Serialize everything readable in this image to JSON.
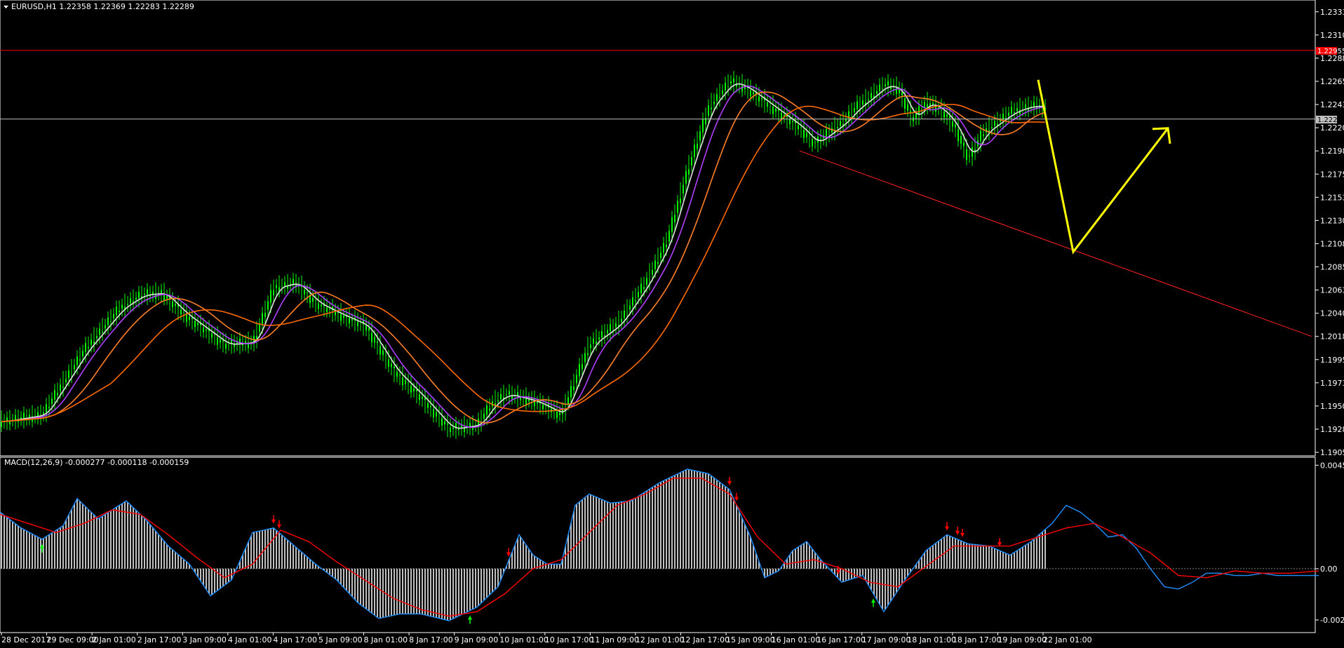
{
  "window": {
    "symbol_header": "EURUSD,H1  1.22358 1.22369 1.22283 1.22289",
    "macd_header": "MACD(12,26,9) -0.000277 -0.000118 -0.000159"
  },
  "colors": {
    "background": "#000000",
    "candles": "#00ff00",
    "ma_fast": "#e0e0e0",
    "ma_purple": "#b040ff",
    "ma_orange": "#ff7f27",
    "ma_slow": "#ff6a00",
    "resistance": "#ff0000",
    "trendline": "#ff2020",
    "forecast": "#ffff00",
    "macd_main": "#1e90ff",
    "macd_signal": "#ff0000",
    "histogram": "#c0c0c0"
  },
  "chart_data": [
    {
      "type": "line",
      "title": "EURUSD,H1",
      "y_ticks": [
        "1.23330",
        "1.23105",
        "1.22880",
        "1.22655",
        "1.22430",
        "1.22205",
        "1.21980",
        "1.21755",
        "1.21530",
        "1.21305",
        "1.21080",
        "1.20855",
        "1.20630",
        "1.20405",
        "1.20180",
        "1.19955",
        "1.19730",
        "1.19505",
        "1.19280",
        "1.19055"
      ],
      "ylim": [
        1.19055,
        1.2339
      ],
      "x_ticks": [
        "28 Dec 2017",
        "29 Dec 09:00",
        "2 Jan 01:00",
        "2 Jan 17:00",
        "3 Jan 09:00",
        "4 Jan 01:00",
        "4 Jan 17:00",
        "5 Jan 09:00",
        "8 Jan 01:00",
        "8 Jan 17:00",
        "9 Jan 09:00",
        "10 Jan 01:00",
        "10 Jan 17:00",
        "11 Jan 09:00",
        "12 Jan 01:00",
        "12 Jan 17:00",
        "15 Jan 09:00",
        "16 Jan 01:00",
        "16 Jan 17:00",
        "17 Jan 09:00",
        "18 Jan 01:00",
        "18 Jan 17:00",
        "19 Jan 09:00",
        "22 Jan 01:00"
      ],
      "price_labels": {
        "resistance": "1.22955",
        "current": "1.22289"
      },
      "close_series": {
        "x": [
          0,
          60,
          120,
          170,
          200,
          230,
          260,
          300,
          320,
          360,
          390,
          420,
          450,
          480,
          520,
          560,
          600,
          640,
          680,
          700,
          720,
          760,
          800,
          840,
          880,
          920,
          950,
          980,
          1010,
          1040,
          1060,
          1080,
          1100,
          1120,
          1140,
          1160,
          1200,
          1220,
          1240,
          1260,
          1280,
          1300,
          1320,
          1340,
          1360,
          1380,
          1400,
          1420,
          1440,
          1460,
          1480,
          1500,
          1520,
          1540,
          1560,
          1580,
          1600,
          1620,
          1640,
          1660,
          1680,
          1700,
          1720,
          1740,
          1760,
          1780,
          1800,
          1820,
          1840,
          1860,
          1880
        ],
        "y": [
          1.1935,
          1.1942,
          1.2005,
          1.2045,
          1.2058,
          1.206,
          1.204,
          1.202,
          1.201,
          1.2012,
          1.2065,
          1.207,
          1.205,
          1.204,
          1.2028,
          1.1985,
          1.1958,
          1.1928,
          1.1932,
          1.1952,
          1.1962,
          1.1955,
          1.1942,
          1.201,
          1.203,
          1.207,
          1.211,
          1.218,
          1.224,
          1.2265,
          1.226,
          1.225,
          1.224,
          1.223,
          1.222,
          1.2205,
          1.2225,
          1.224,
          1.225,
          1.2262,
          1.2258,
          1.2228,
          1.2245,
          1.2238,
          1.2222,
          1.219,
          1.2215,
          1.2225,
          1.2235,
          1.224,
          1.2242,
          1.2236,
          1.2258,
          1.2275,
          1.226,
          1.2245,
          1.224,
          1.2233,
          1.224,
          1.2245,
          1.225,
          1.2248,
          1.224,
          1.2233,
          1.2236,
          1.224,
          1.226,
          1.225,
          1.224,
          1.2232,
          1.2229
        ]
      },
      "moving_averages": [
        {
          "color_key": "ma_fast",
          "period": 5
        },
        {
          "color_key": "ma_purple",
          "period": 10
        },
        {
          "color_key": "ma_orange",
          "period": 20
        },
        {
          "color_key": "ma_slow",
          "period": 40
        }
      ],
      "annotations": {
        "resistance_price": 1.22955,
        "current_price": 1.22289,
        "trendline": [
          [
            1140,
            1.2198
          ],
          [
            1870,
            1.2018
          ]
        ],
        "forecast": [
          [
            1480,
            1.2267
          ],
          [
            1530,
            1.21
          ],
          [
            1665,
            1.222
          ]
        ]
      }
    },
    {
      "type": "bar",
      "title": "MACD(12,26,9)",
      "y_ticks": [
        "0.004572",
        "0.00",
        "-0.002266"
      ],
      "ylim": [
        -0.0027,
        0.0048
      ],
      "main_line": {
        "x": [
          0,
          30,
          60,
          90,
          110,
          140,
          180,
          210,
          240,
          270,
          300,
          330,
          360,
          390,
          420,
          450,
          480,
          510,
          540,
          570,
          600,
          640,
          680,
          710,
          740,
          760,
          780,
          800,
          820,
          840,
          870,
          900,
          940,
          980,
          1010,
          1040,
          1070,
          1090,
          1110,
          1130,
          1150,
          1170,
          1200,
          1230,
          1260,
          1290,
          1320,
          1350,
          1380,
          1410,
          1440,
          1470,
          1500,
          1520,
          1540,
          1560,
          1580,
          1600,
          1620,
          1640,
          1660,
          1680,
          1700,
          1720,
          1740,
          1760,
          1780,
          1800,
          1820,
          1840,
          1860,
          1880
        ],
        "y": [
          0.0025,
          0.0018,
          0.0013,
          0.0019,
          0.0031,
          0.0022,
          0.003,
          0.0021,
          0.001,
          0.0002,
          -0.0012,
          -0.0005,
          0.0016,
          0.0018,
          0.001,
          0.0002,
          -0.0005,
          -0.0015,
          -0.0022,
          -0.002,
          -0.002,
          -0.0023,
          -0.0017,
          -0.0008,
          0.0015,
          0.0006,
          0.0002,
          0.0002,
          0.0028,
          0.0033,
          0.0029,
          0.003,
          0.0038,
          0.0044,
          0.0042,
          0.0035,
          0.0014,
          -0.0004,
          -0.0001,
          0.0008,
          0.0012,
          0.0004,
          -0.0006,
          -0.0003,
          -0.0019,
          -0.0005,
          0.0008,
          0.0015,
          0.0011,
          0.001,
          0.0006,
          0.0012,
          0.002,
          0.0028,
          0.0025,
          0.002,
          0.0014,
          0.0015,
          0.0009,
          0.0,
          -0.0008,
          -0.0009,
          -0.0006,
          -0.0002,
          -0.0002,
          -0.0003,
          -0.0003,
          -0.0002,
          -0.0003,
          -0.0003,
          -0.0003,
          -0.0003
        ]
      },
      "signal_line": {
        "x": [
          0,
          40,
          80,
          120,
          160,
          200,
          240,
          280,
          320,
          360,
          400,
          440,
          480,
          520,
          560,
          600,
          640,
          680,
          720,
          760,
          800,
          840,
          880,
          920,
          960,
          1000,
          1040,
          1080,
          1120,
          1160,
          1200,
          1240,
          1280,
          1320,
          1360,
          1400,
          1440,
          1480,
          1520,
          1560,
          1600,
          1640,
          1680,
          1720,
          1760,
          1800,
          1840,
          1880
        ],
        "y": [
          0.0024,
          0.002,
          0.0016,
          0.002,
          0.0026,
          0.0024,
          0.0015,
          0.0005,
          -0.0004,
          0.0002,
          0.0017,
          0.0012,
          0.0003,
          -0.0005,
          -0.0013,
          -0.0018,
          -0.0021,
          -0.0019,
          -0.0011,
          0.0,
          0.0004,
          0.0016,
          0.0028,
          0.0033,
          0.004,
          0.004,
          0.0033,
          0.0014,
          0.0002,
          0.0004,
          0.0,
          -0.0006,
          -0.0008,
          0.0001,
          0.001,
          0.001,
          0.001,
          0.0014,
          0.0018,
          0.002,
          0.0014,
          0.0007,
          -0.0003,
          -0.0004,
          -0.0001,
          -0.0002,
          -0.0002,
          -0.0001
        ]
      }
    }
  ]
}
